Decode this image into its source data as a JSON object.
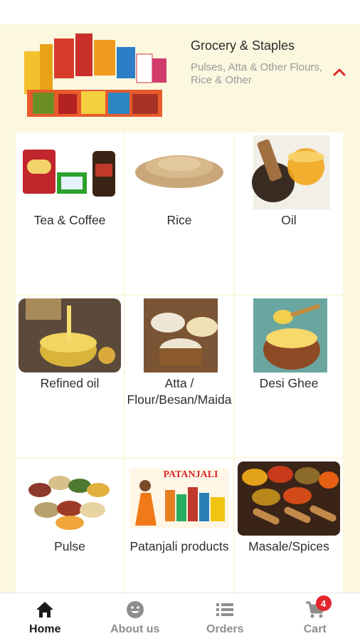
{
  "category": {
    "title": "Grocery & Staples",
    "subtitle": "Pulses, Atta & Other Flours, Rice & Other",
    "collapse_icon": "chevron-up-icon",
    "accent_color": "#e2262b"
  },
  "tiles": [
    {
      "label": "Tea & Coffee",
      "icon": "tea-coffee-image"
    },
    {
      "label": "Rice",
      "icon": "rice-image"
    },
    {
      "label": "Oil",
      "icon": "oil-image"
    },
    {
      "label": "Refined oil",
      "icon": "refined-oil-image"
    },
    {
      "label": "Atta / Flour/Besan/Maida",
      "icon": "flour-image"
    },
    {
      "label": "Desi Ghee",
      "icon": "ghee-image"
    },
    {
      "label": "Pulse",
      "icon": "pulse-image"
    },
    {
      "label": "Patanjali products",
      "icon": "patanjali-image",
      "brand_text": "PATANJALI"
    },
    {
      "label": "Masale/Spices",
      "icon": "spices-image"
    }
  ],
  "bottom_nav": {
    "items": [
      {
        "label": "Home",
        "icon": "home-icon",
        "active": true
      },
      {
        "label": "About us",
        "icon": "smiley-icon",
        "active": false
      },
      {
        "label": "Orders",
        "icon": "list-icon",
        "active": false
      },
      {
        "label": "Cart",
        "icon": "cart-icon",
        "active": false,
        "badge": "4"
      }
    ]
  }
}
